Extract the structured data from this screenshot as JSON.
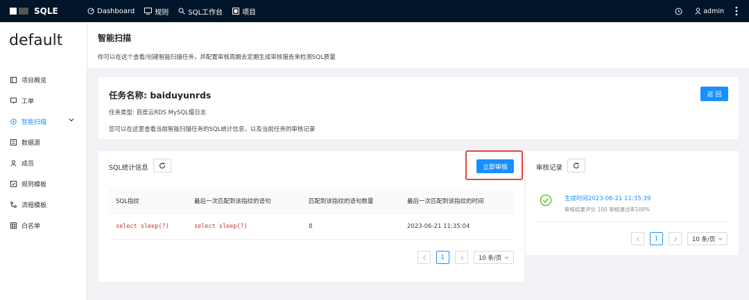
{
  "app": {
    "brand": "SQLE",
    "user": "admin"
  },
  "nav": [
    {
      "label": "Dashboard",
      "icon": "dashboard-icon"
    },
    {
      "label": "规则",
      "icon": "monitor-icon"
    },
    {
      "label": "SQL工作台",
      "icon": "search-icon"
    },
    {
      "label": "项目",
      "icon": "project-icon"
    }
  ],
  "sidebar": {
    "project": "default",
    "items": [
      {
        "label": "项目概览",
        "icon": "overview-icon"
      },
      {
        "label": "工单",
        "icon": "order-icon"
      },
      {
        "label": "智能扫描",
        "icon": "scan-icon",
        "active": true
      },
      {
        "label": "数据源",
        "icon": "datasource-icon"
      },
      {
        "label": "成员",
        "icon": "member-icon"
      },
      {
        "label": "规则模板",
        "icon": "rule-template-icon"
      },
      {
        "label": "流程模板",
        "icon": "flow-template-icon"
      },
      {
        "label": "白名单",
        "icon": "whitelist-icon"
      }
    ]
  },
  "header": {
    "title": "智能扫描",
    "desc": "你可以在这个查看/创建智能扫描任务，并配置审核周期去定期生成审核报告来检测SQL质量"
  },
  "task": {
    "name": "任务名称: baiduyunrds",
    "type": "任务类型: 百度云RDS MySQL慢日志",
    "desc": "您可以在这里查看当前智能扫描任务的SQL统计信息，以及当前任务的审核记录",
    "back": "返 回"
  },
  "sql_stats": {
    "title": "SQL统计信息",
    "audit_button": "立即审核",
    "columns": [
      "SQL指纹",
      "最后一次匹配到该指纹的语句",
      "匹配到该指纹的语句数量",
      "最后一次匹配到该指纹的时间"
    ],
    "rows": [
      {
        "fingerprint": "select sleep(?)",
        "last_sql": "select sleep(?)",
        "count": "8",
        "last_time": "2023-06-21 11:35:04"
      }
    ],
    "pager": {
      "page": "1",
      "size": "10 条/页"
    }
  },
  "records": {
    "title": "审核记录",
    "items": [
      {
        "time": "生成时间2023-06-21 11:35:39",
        "meta": "审核结果评分 100  审核通过率100%"
      }
    ],
    "pager": {
      "page": "1",
      "size": "10 条/页"
    }
  },
  "colors": {
    "primary": "#1890ff",
    "topbar": "#001529",
    "highlight": "#e0443a",
    "success": "#52c41a"
  }
}
